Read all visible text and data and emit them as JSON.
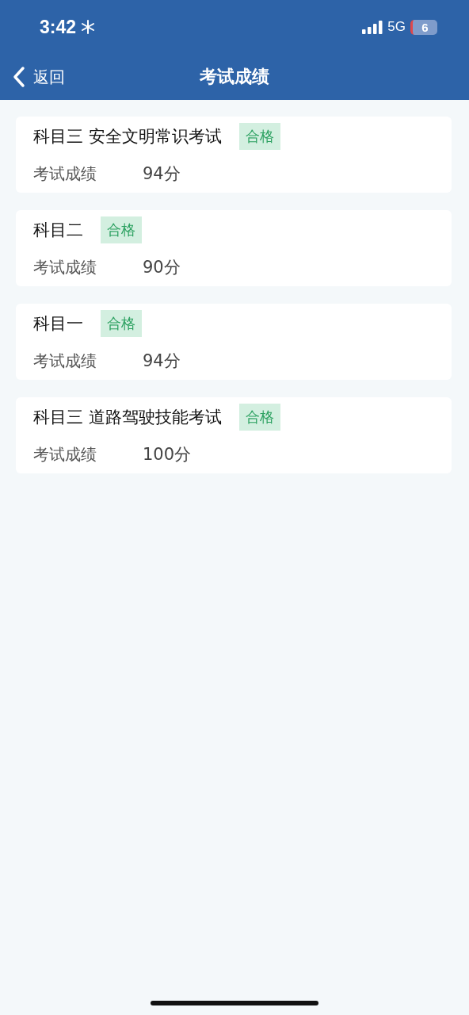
{
  "status_bar": {
    "time": "3:42",
    "network": "5G",
    "battery": "6"
  },
  "nav": {
    "back": "返回",
    "title": "考试成绩"
  },
  "results": [
    {
      "subject": "科目三 安全文明常识考试",
      "status": "合格",
      "passed": true,
      "score_label": "考试成绩",
      "score": "94分"
    },
    {
      "subject": "科目二",
      "status": "合格",
      "passed": true,
      "score_label": "考试成绩",
      "score": "90分"
    },
    {
      "subject": "科目一",
      "status": "合格",
      "passed": true,
      "score_label": "考试成绩",
      "score": "94分"
    },
    {
      "subject": "科目三 道路驾驶技能考试",
      "status": "合格",
      "passed": true,
      "score_label": "考试成绩",
      "score": "100分"
    }
  ]
}
